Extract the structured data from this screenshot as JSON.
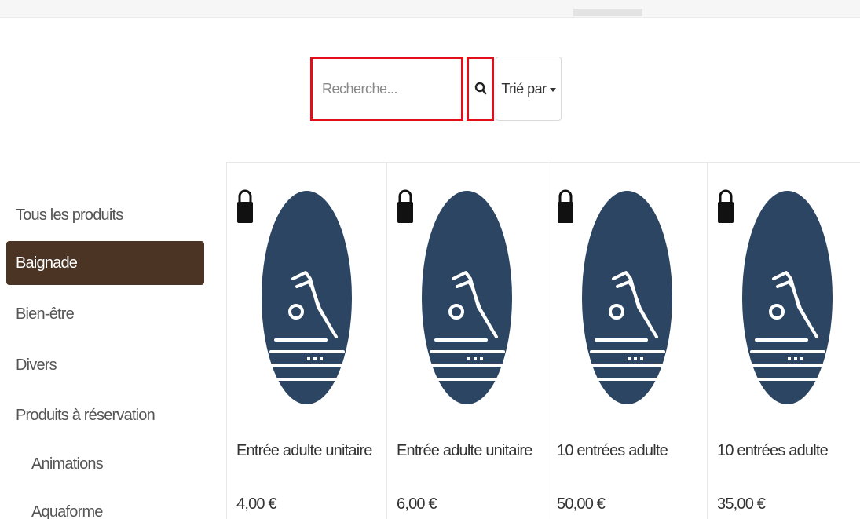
{
  "search": {
    "placeholder": "Recherche...",
    "value": ""
  },
  "sort": {
    "label": "Trié par"
  },
  "sidebar": {
    "items": [
      {
        "label": "Tous les produits"
      },
      {
        "label": "Baignade",
        "active": true
      },
      {
        "label": "Bien-être"
      },
      {
        "label": "Divers"
      },
      {
        "label": "Produits à réservation"
      },
      {
        "label": "Animations",
        "sub": true
      },
      {
        "label": "Aquaforme",
        "sub": true
      }
    ]
  },
  "products": [
    {
      "name": "Entrée adulte unitaire",
      "price": "4,00 €",
      "icon": "lock-icon",
      "image": "swimming-pictogram"
    },
    {
      "name": "Entrée adulte unitaire",
      "price": "6,00 €",
      "icon": "lock-icon",
      "image": "swimming-pictogram"
    },
    {
      "name": "10 entrées adulte",
      "price": "50,00 €",
      "icon": "lock-icon",
      "image": "swimming-pictogram"
    },
    {
      "name": "10 entrées adulte",
      "price": "35,00 €",
      "icon": "lock-icon",
      "image": "swimming-pictogram"
    }
  ],
  "colors": {
    "accent_active": "#4b3424",
    "highlight_border": "#e20f1b",
    "product_image": "#2b4562"
  }
}
